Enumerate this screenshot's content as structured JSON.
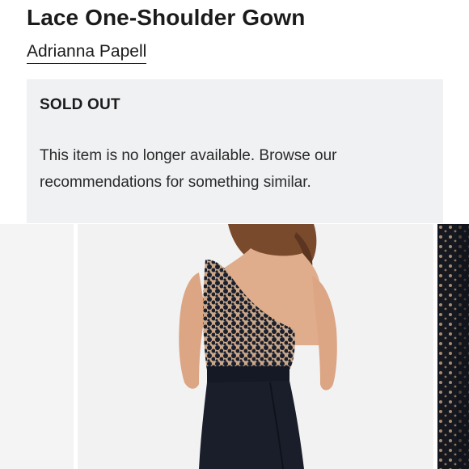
{
  "product": {
    "title": "Lace One-Shoulder Gown",
    "brand": "Adrianna Papell"
  },
  "notice": {
    "heading": "SOLD OUT",
    "message": "This item is no longer available. Browse our recommendations for something similar."
  },
  "gallery": {
    "images": [
      {
        "name": "previous-product-image"
      },
      {
        "name": "gown-back-view-image"
      },
      {
        "name": "lace-detail-image"
      }
    ]
  },
  "colors": {
    "notice_background": "#f0f1f3",
    "text": "#1b1b1b",
    "gown": "#1a1e2a"
  }
}
